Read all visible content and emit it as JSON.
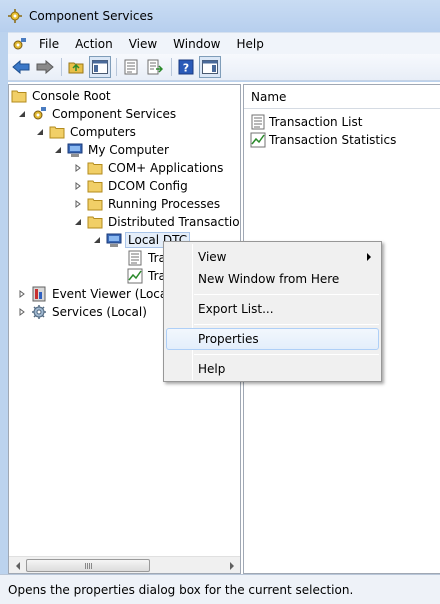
{
  "window": {
    "title": "Component Services"
  },
  "menubar": {
    "items": [
      "File",
      "Action",
      "View",
      "Window",
      "Help"
    ]
  },
  "toolbar": {
    "buttons": [
      "back-arrow-icon",
      "forward-arrow-icon",
      "up-folder-icon",
      "show-hide-tree-icon",
      "properties-icon",
      "export-list-icon",
      "help-icon",
      "show-hide-action-pane-icon"
    ]
  },
  "tree": {
    "items": [
      {
        "label": "Console Root"
      },
      {
        "label": "Component Services"
      },
      {
        "label": "Computers"
      },
      {
        "label": "My Computer"
      },
      {
        "label": "COM+ Applications"
      },
      {
        "label": "DCOM Config"
      },
      {
        "label": "Running Processes"
      },
      {
        "label": "Distributed Transaction C"
      },
      {
        "label": "Local DTC"
      },
      {
        "label": "Tra"
      },
      {
        "label": "Tra"
      },
      {
        "label": "Event Viewer (Local)"
      },
      {
        "label": "Services (Local)"
      }
    ]
  },
  "list": {
    "header": "Name",
    "items": [
      {
        "label": "Transaction List"
      },
      {
        "label": "Transaction Statistics"
      }
    ]
  },
  "context_menu": {
    "items": [
      {
        "label": "View",
        "submenu": true
      },
      {
        "label": "New Window from Here"
      },
      {
        "label": "Export List..."
      },
      {
        "label": "Properties",
        "highlighted": true
      },
      {
        "label": "Help"
      }
    ]
  },
  "status": {
    "text": "Opens the properties dialog box for the current selection."
  },
  "colors": {
    "titlebar": "#b9d1ee",
    "selection": "#e5eef9",
    "menu_hover_border": "#aecff7"
  }
}
